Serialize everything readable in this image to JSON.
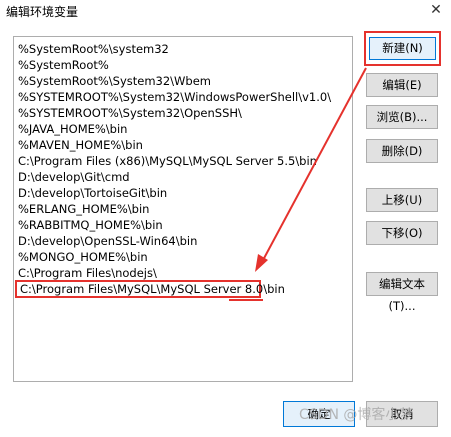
{
  "window": {
    "title": "编辑环境变量",
    "close_glyph": "✕"
  },
  "path_list": {
    "items": [
      "%SystemRoot%\\system32",
      "%SystemRoot%",
      "%SystemRoot%\\System32\\Wbem",
      "%SYSTEMROOT%\\System32\\WindowsPowerShell\\v1.0\\",
      "%SYSTEMROOT%\\System32\\OpenSSH\\",
      "%JAVA_HOME%\\bin",
      "%MAVEN_HOME%\\bin",
      "C:\\Program Files (x86)\\MySQL\\MySQL Server 5.5\\bin",
      "D:\\develop\\Git\\cmd",
      "D:\\develop\\TortoiseGit\\bin",
      "%ERLANG_HOME%\\bin",
      "%RABBITMQ_HOME%\\bin",
      "D:\\develop\\OpenSSL-Win64\\bin",
      "%MONGO_HOME%\\bin",
      "C:\\Program Files\\nodejs\\",
      "C:\\Program Files\\MySQL\\MySQL Server 8.0\\bin"
    ]
  },
  "buttons": {
    "new": "新建(N)",
    "edit": "编辑(E)",
    "browse": "浏览(B)...",
    "delete": "删除(D)",
    "move_up": "上移(U)",
    "move_down": "下移(O)",
    "edit_text": "编辑文本(T)...",
    "ok": "确定",
    "cancel": "取消"
  },
  "watermark": "CSDN @博客小梦",
  "colors": {
    "highlight_red": "#e5322d",
    "accent_blue": "#0078d7"
  }
}
